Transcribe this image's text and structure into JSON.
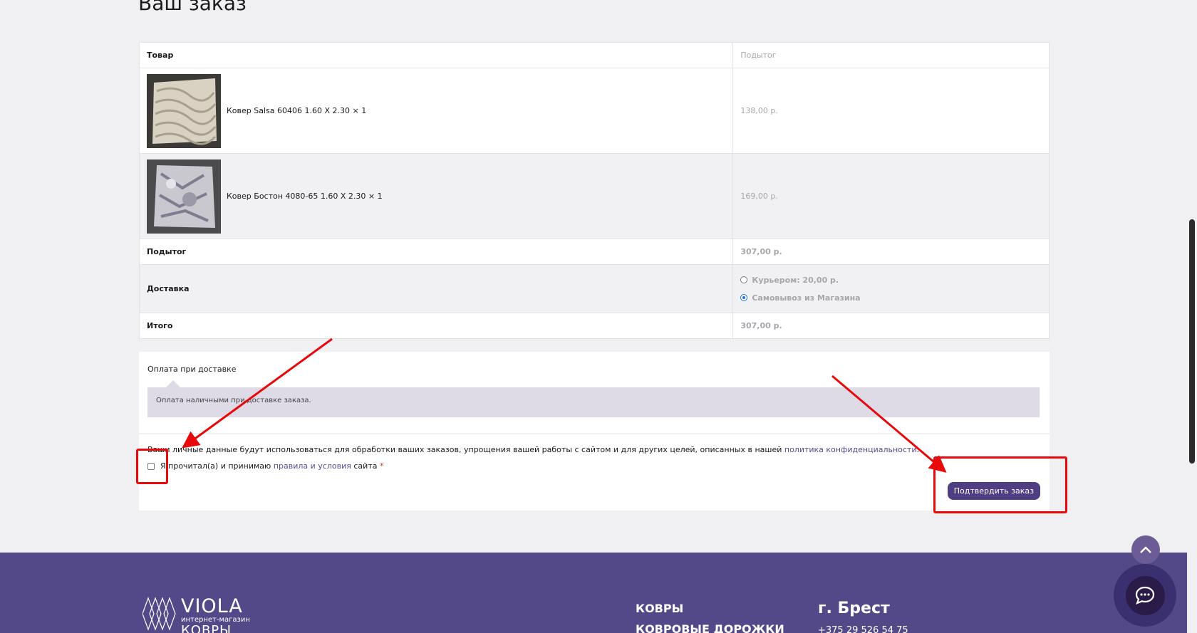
{
  "page": {
    "title": "Ваш заказ"
  },
  "table": {
    "head_product": "Товар",
    "head_subtotal": "Подытог",
    "items": [
      {
        "name": "Ковер Salsa 60406 1.60 X 2.30 × 1",
        "price": "138,00 р.",
        "thumb_icon": "rug-salsa-image"
      },
      {
        "name": "Ковер Бостон 4080-65 1.60 X 2.30 × 1",
        "price": "169,00 р.",
        "thumb_icon": "rug-boston-image"
      }
    ],
    "subtotal_label": "Подытог",
    "subtotal_value": "307,00 р.",
    "shipping_label": "Доставка",
    "shipping_options": [
      {
        "label": "Курьером: 20,00 р.",
        "selected": false
      },
      {
        "label": "Самовывоз из Магазина",
        "selected": true
      }
    ],
    "total_label": "Итого",
    "total_value": "307,00 р."
  },
  "payment": {
    "method": "Оплата при доставке",
    "description": "Оплата наличными при доставке заказа.",
    "privacy_text": "Ваши личные данные будут использоваться для обработки ваших заказов, упрощения вашей работы с сайтом и для других целей, описанных в нашей",
    "privacy_link": "политика конфиденциальности",
    "privacy_end": ".",
    "terms_prefix": "Я прочитал(а) и принимаю",
    "terms_link": "правила и условия",
    "terms_suffix": "сайта",
    "required_mark": "*",
    "confirm_button": "Подтвердить заказ"
  },
  "annotations": {
    "highlight_color": "#e8090a"
  },
  "footer": {
    "logo_name": "VIOLA",
    "logo_sub": "интернет-магазин",
    "logo_word": "КОВРЫ",
    "nav": [
      "КОВРЫ",
      "КОВРОВЫЕ ДОРОЖКИ"
    ],
    "city": "г. Брест",
    "phone": "+375 29 526 54 75",
    "background_color": "#534989"
  },
  "colors": {
    "accent": "#4f3f82",
    "link": "#5a4a8d",
    "radio_selected": "#1f6fde"
  }
}
